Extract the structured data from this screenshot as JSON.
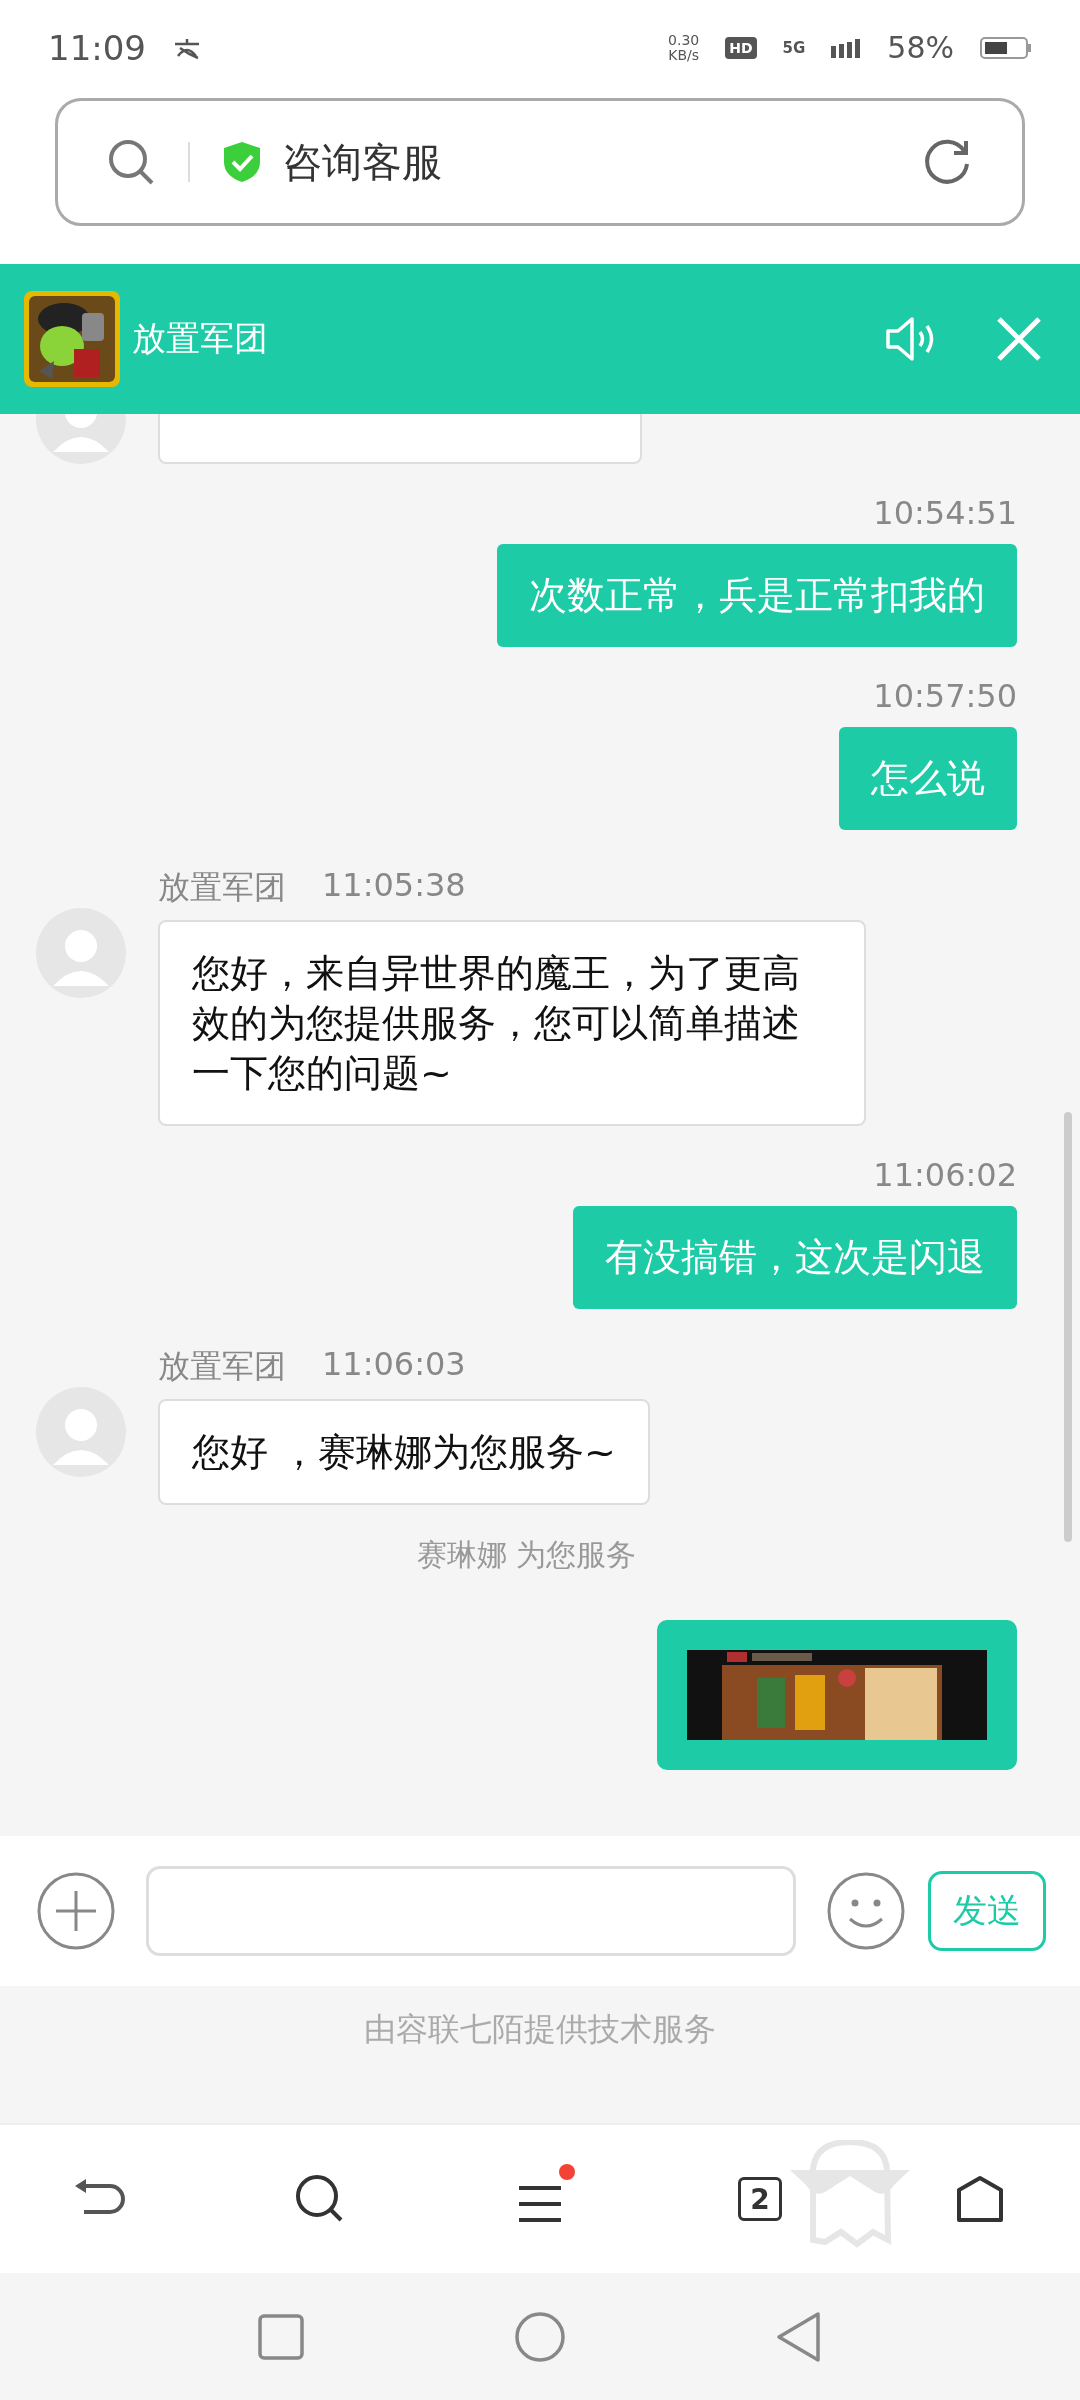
{
  "status_bar": {
    "time": "11:09",
    "net_speed": "0.30",
    "net_unit": "KB/s",
    "hd": "HD",
    "network": "5G",
    "battery": "58%"
  },
  "address_bar": {
    "title": "咨询客服"
  },
  "header": {
    "title": "放置军团"
  },
  "messages": [
    {
      "kind": "incoming_cut"
    },
    {
      "kind": "time",
      "text": "10:54:51"
    },
    {
      "kind": "outgoing",
      "text": "次数正常，兵是正常扣我的"
    },
    {
      "kind": "time",
      "text": "10:57:50"
    },
    {
      "kind": "outgoing",
      "text": "怎么说"
    },
    {
      "kind": "incoming",
      "name": "放置军团",
      "time": "11:05:38",
      "text": "您好，来自异世界的魔王，为了更高效的为您提供服务，您可以简单描述一下您的问题~"
    },
    {
      "kind": "time",
      "text": "11:06:02"
    },
    {
      "kind": "outgoing",
      "text": "有没搞错，这次是闪退"
    },
    {
      "kind": "incoming",
      "name": "放置军团",
      "time": "11:06:03",
      "text": "您好 ，赛琳娜为您服务~"
    },
    {
      "kind": "notice",
      "text": "赛琳娜 为您服务"
    },
    {
      "kind": "image_outgoing"
    }
  ],
  "composer": {
    "send": "发送"
  },
  "footer": {
    "text": "由容联七陌提供技术服务"
  },
  "browser_nav": {
    "tab_count": "2",
    "menu_badge": true
  }
}
